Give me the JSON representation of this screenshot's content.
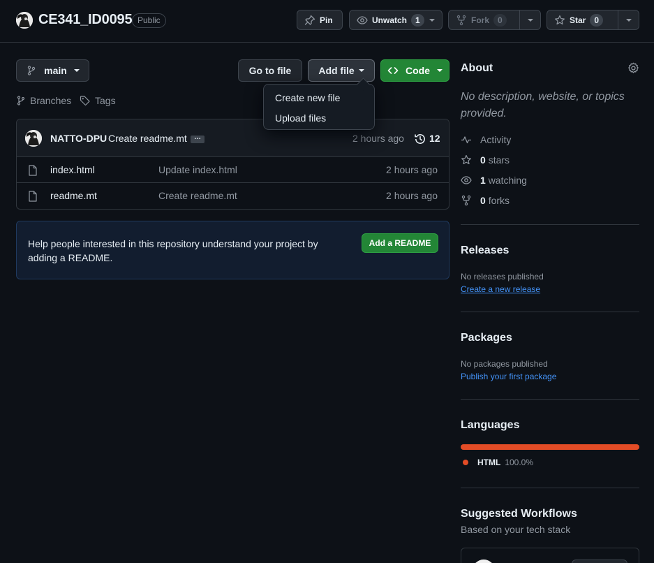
{
  "header": {
    "repo_name": "CE341_ID0095",
    "visibility": "Public",
    "pin_label": "Pin",
    "unwatch_label": "Unwatch",
    "unwatch_count": "1",
    "fork_label": "Fork",
    "fork_count": "0",
    "star_label": "Star",
    "star_count": "0"
  },
  "toolbar": {
    "branch": "main",
    "go_to_file": "Go to file",
    "add_file": "Add file",
    "code": "Code",
    "branches": "Branches",
    "tags": "Tags"
  },
  "add_file_menu": {
    "items": [
      "Create new file",
      "Upload files"
    ]
  },
  "latest_commit": {
    "author": "NATTO-DPU",
    "message": "Create readme.mt",
    "ellipsis": "…",
    "time": "2 hours ago",
    "commit_count": "12"
  },
  "files": [
    {
      "name": "index.html",
      "message": "Update index.html",
      "time": "2 hours ago"
    },
    {
      "name": "readme.mt",
      "message": "Create readme.mt",
      "time": "2 hours ago"
    }
  ],
  "readme_banner": {
    "text_line1": "Help people interested in this repository understand your project by",
    "text_line2": "adding a README.",
    "button": "Add a README"
  },
  "sidebar": {
    "about_title": "About",
    "about_desc_line1": "No description, website, or topics",
    "about_desc_line2": "provided.",
    "activity": "Activity",
    "stars_count": "0",
    "stars_label": "stars",
    "watching_count": "1",
    "watching_label": "watching",
    "forks_count": "0",
    "forks_label": "forks",
    "releases_title": "Releases",
    "releases_empty": "No releases published",
    "releases_link": "Create a new release",
    "packages_title": "Packages",
    "packages_empty": "No packages published",
    "packages_link": "Publish your first package",
    "languages_title": "Languages",
    "language_name": "HTML",
    "language_percent": "100.0%",
    "language_share": 1.0,
    "language_color": "#e34c26",
    "workflows_title": "Suggested Workflows",
    "workflows_subtitle": "Based on your tech stack"
  },
  "colors": {
    "accent_blue": "#4493f8",
    "green_button": "#238636",
    "background": "#0d1117"
  }
}
